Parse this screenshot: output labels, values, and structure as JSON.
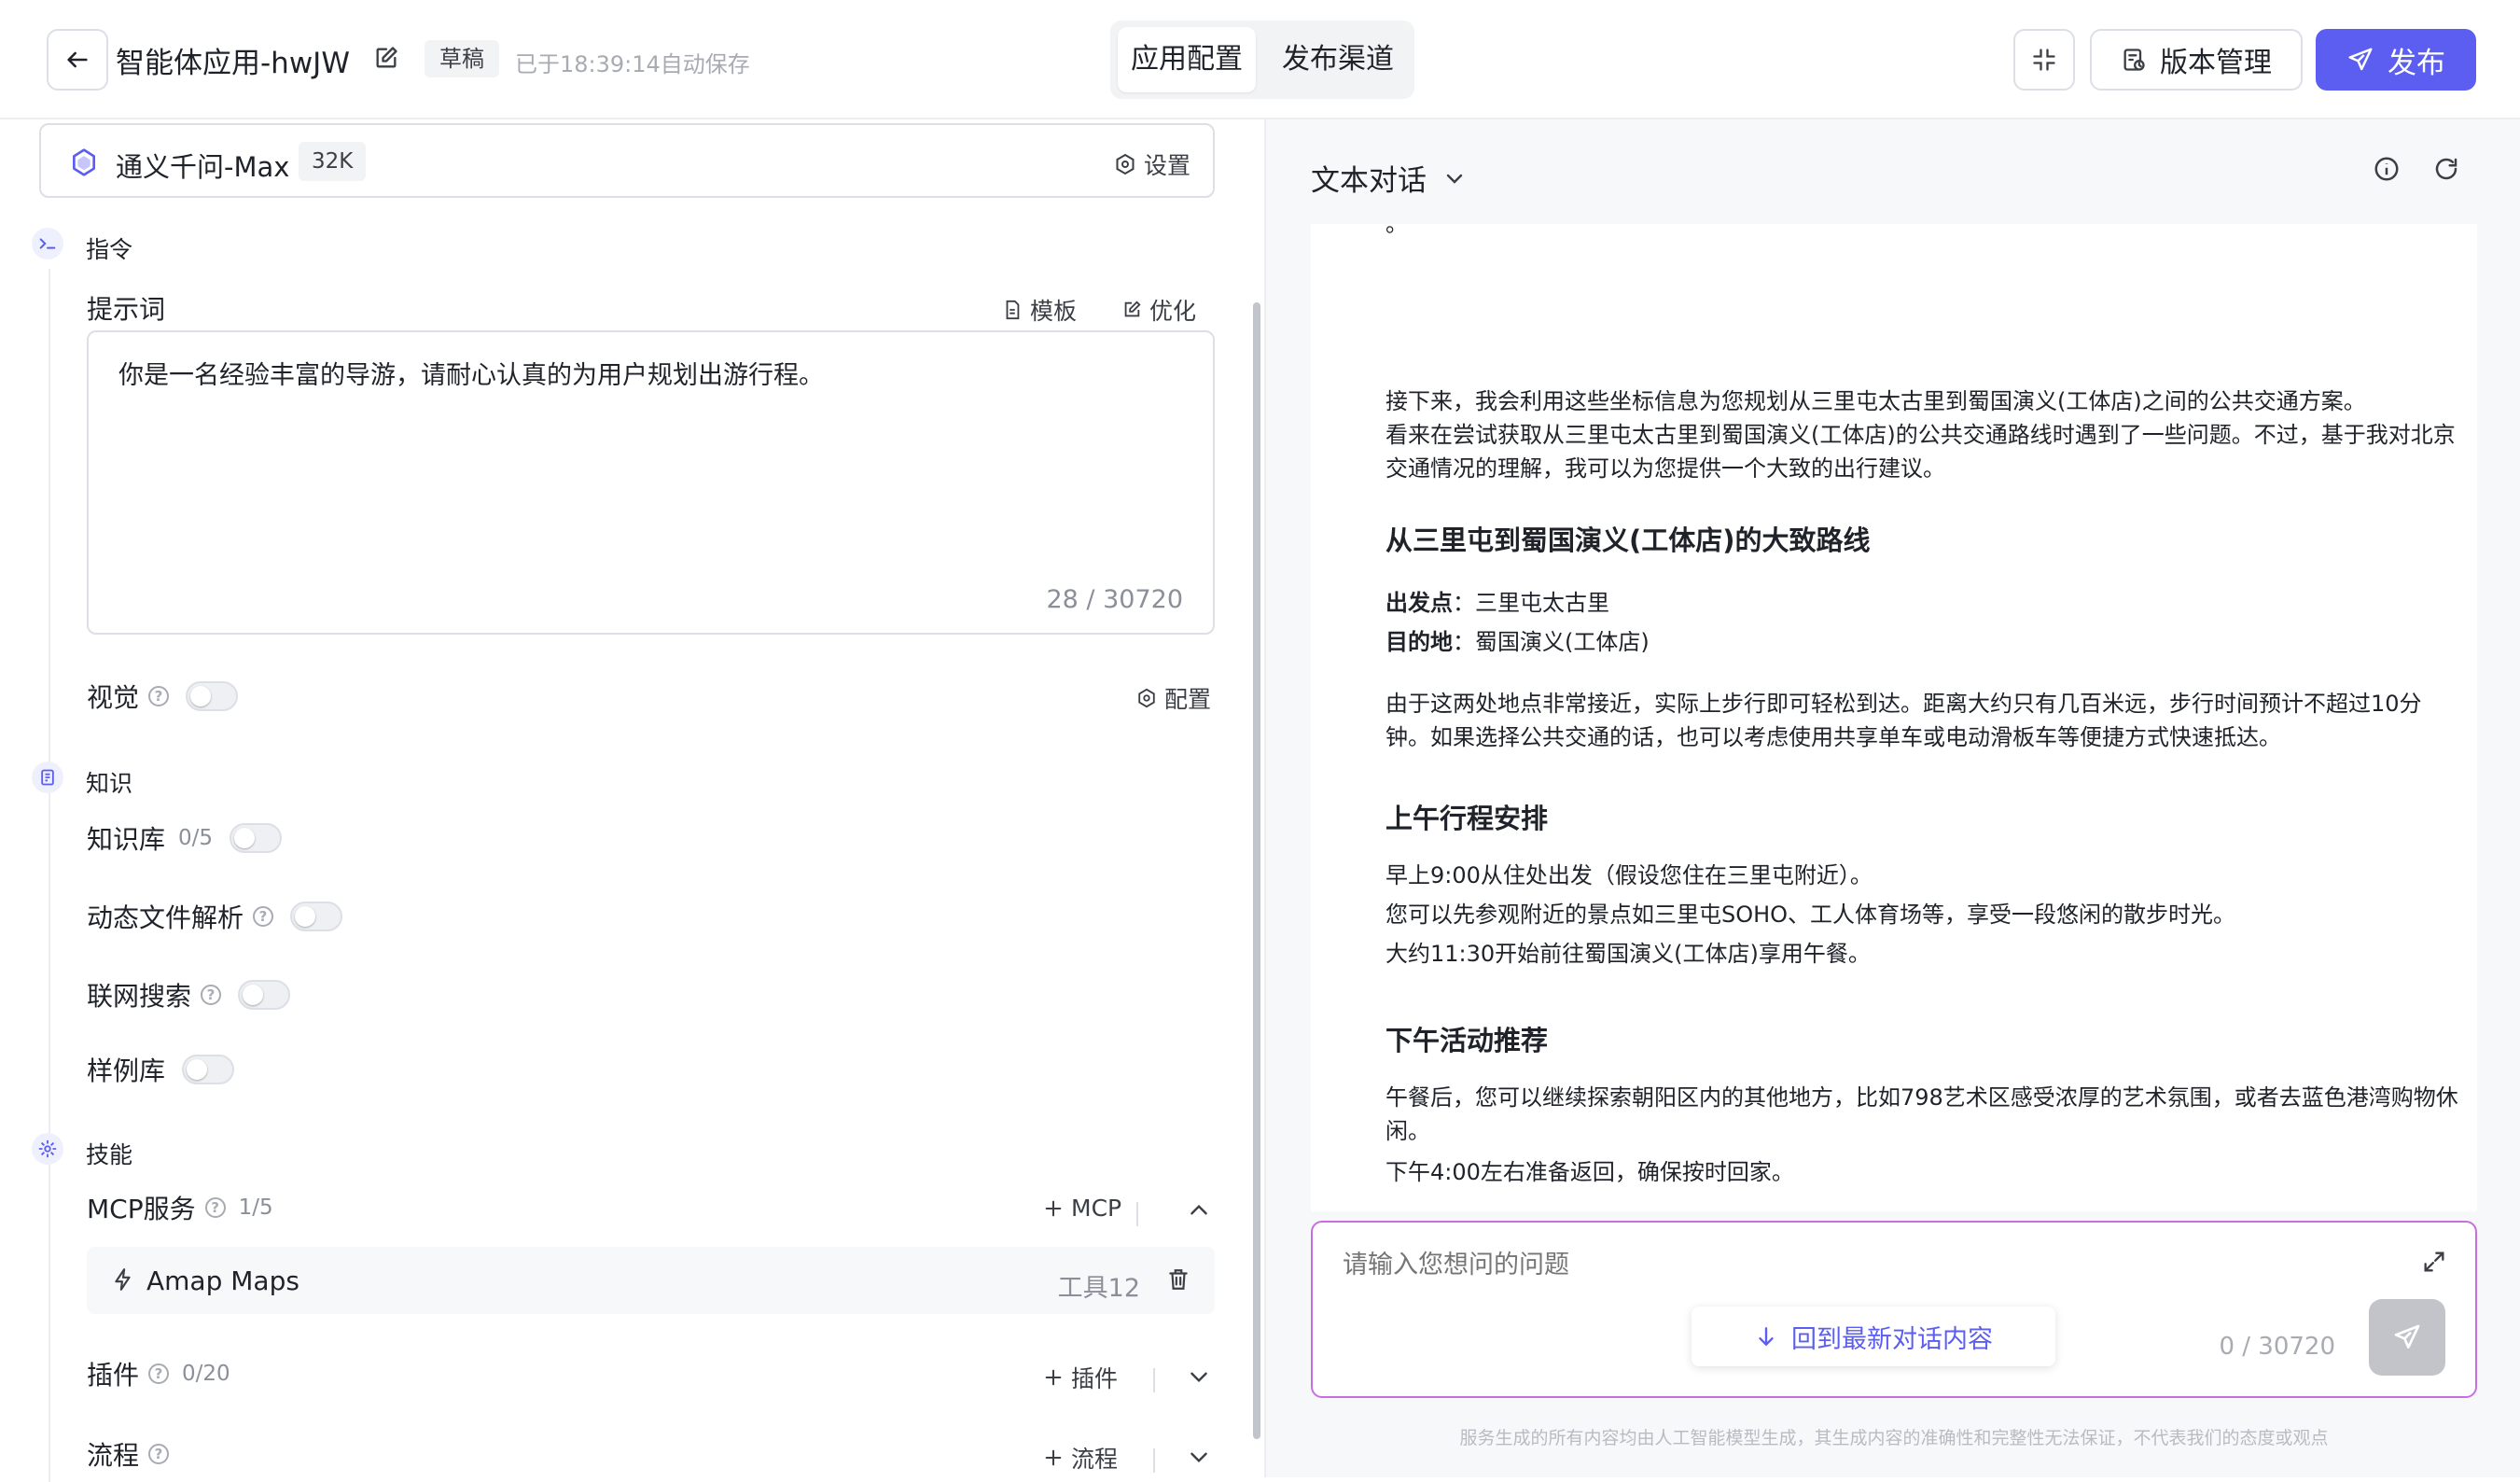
{
  "header": {
    "app_title": "智能体应用-hwJW",
    "draft_badge": "草稿",
    "autosave": "已于18:39:14自动保存",
    "tabs": [
      "应用配置",
      "发布渠道"
    ],
    "active_tab": "应用配置",
    "version_label": "版本管理",
    "publish_label": "发布"
  },
  "left": {
    "model": {
      "name": "通义千问-Max",
      "context": "32K",
      "settings_label": "设置"
    },
    "instruction": {
      "section_title": "指令",
      "prompt_label": "提示词",
      "template_label": "模板",
      "optimize_label": "优化",
      "prompt_text": "你是一名经验丰富的导游，请耐心认真的为用户规划出游行程。",
      "counter": "28 / 30720",
      "vision_label": "视觉",
      "config_label": "配置"
    },
    "knowledge": {
      "section_title": "知识",
      "kb_label": "知识库",
      "kb_count": "0/5",
      "dynamic_label": "动态文件解析",
      "web_label": "联网搜索",
      "examples_label": "样例库"
    },
    "skills": {
      "section_title": "技能",
      "mcp_label": "MCP服务",
      "mcp_count": "1/5",
      "add_mcp": "MCP",
      "mcp_item_name": "Amap Maps",
      "mcp_item_tools": "工具12",
      "plugin_label": "插件",
      "plugin_count": "0/20",
      "add_plugin": "插件",
      "flow_label": "流程",
      "add_flow": "流程"
    }
  },
  "right": {
    "chat_mode": "文本对话",
    "messages": {
      "partial_top": "。",
      "p1a": "接下来，我会利用这些坐标信息为您规划从三里屯太古里到蜀国演义(工体店)之间的公共交通方案。",
      "p1b": "看来在尝试获取从三里屯太古里到蜀国演义(工体店)的公共交通路线时遇到了一些问题。不过，基于我对北京交通情况的理解，我可以为您提供一个大致的出行建议。",
      "h1": "从三里屯到蜀国演义(工体店)的大致路线",
      "start_label": "出发点",
      "start_value": "：三里屯太古里",
      "dest_label": "目的地",
      "dest_value": "：蜀国演义(工体店)",
      "p2": "由于这两处地点非常接近，实际上步行即可轻松到达。距离大约只有几百米远，步行时间预计不超过10分钟。如果选择公共交通的话，也可以考虑使用共享单车或电动滑板车等便捷方式快速抵达。",
      "h2": "上午行程安排",
      "p3a": "早上9:00从住处出发（假设您住在三里屯附近）。",
      "p3b": "您可以先参观附近的景点如三里屯SOHO、工人体育场等，享受一段悠闲的散步时光。",
      "p3c": "大约11:30开始前往蜀国演义(工体店)享用午餐。",
      "h3": "下午活动推荐",
      "p4a": "午餐后，您可以继续探索朝阳区内的其他地方，比如798艺术区感受浓厚的艺术氛围，或者去蓝色港湾购物休闲。",
      "p4b": "下午4:00左右准备返回，确保按时回家。"
    },
    "input_placeholder": "请输入您想问的问题",
    "input_counter": "0 / 30720",
    "latest_label": "回到最新对话内容",
    "disclaimer": "服务生成的所有内容均由人工智能模型生成，其生成内容的准确性和完整性无法保证，不代表我们的态度或观点"
  }
}
